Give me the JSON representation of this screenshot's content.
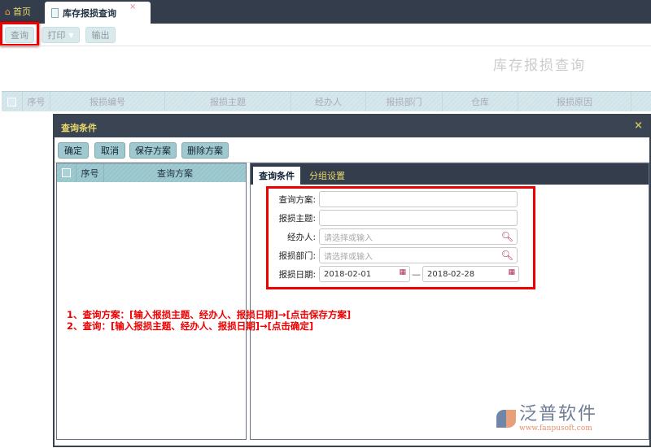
{
  "tabs": {
    "home": "首页",
    "active": "库存报损查询",
    "close": "×"
  },
  "toolbar": {
    "query": "查询",
    "print": "打印",
    "export": "输出"
  },
  "page_title": "库存报损查询",
  "table": {
    "columns": [
      "序号",
      "报损编号",
      "报损主题",
      "经办人",
      "报损部门",
      "仓库",
      "报损原因"
    ]
  },
  "dialog": {
    "title": "查询条件",
    "close": "×",
    "buttons": {
      "ok": "确定",
      "cancel": "取消",
      "save": "保存方案",
      "delete": "删除方案"
    },
    "left_columns": [
      "序号",
      "查询方案"
    ],
    "tabs": [
      "查询条件",
      "分组设置"
    ],
    "form": {
      "scheme": {
        "label": "查询方案:",
        "value": ""
      },
      "subject": {
        "label": "报损主题:",
        "value": ""
      },
      "handler": {
        "label": "经办人:",
        "placeholder": "请选择或输入"
      },
      "dept": {
        "label": "报损部门:",
        "placeholder": "请选择或输入"
      },
      "date": {
        "label": "报损日期:",
        "from": "2018-02-01",
        "sep": "—",
        "to": "2018-02-28"
      }
    },
    "notes": [
      "1、查询方案：[输入报损主题、经办人、报损日期]→[点击保存方案]",
      "2、查询：[输入报损主题、经办人、报损日期]→[点击确定]"
    ]
  },
  "logo": {
    "name": "泛普软件",
    "url": "www.fanpusoft.com"
  }
}
